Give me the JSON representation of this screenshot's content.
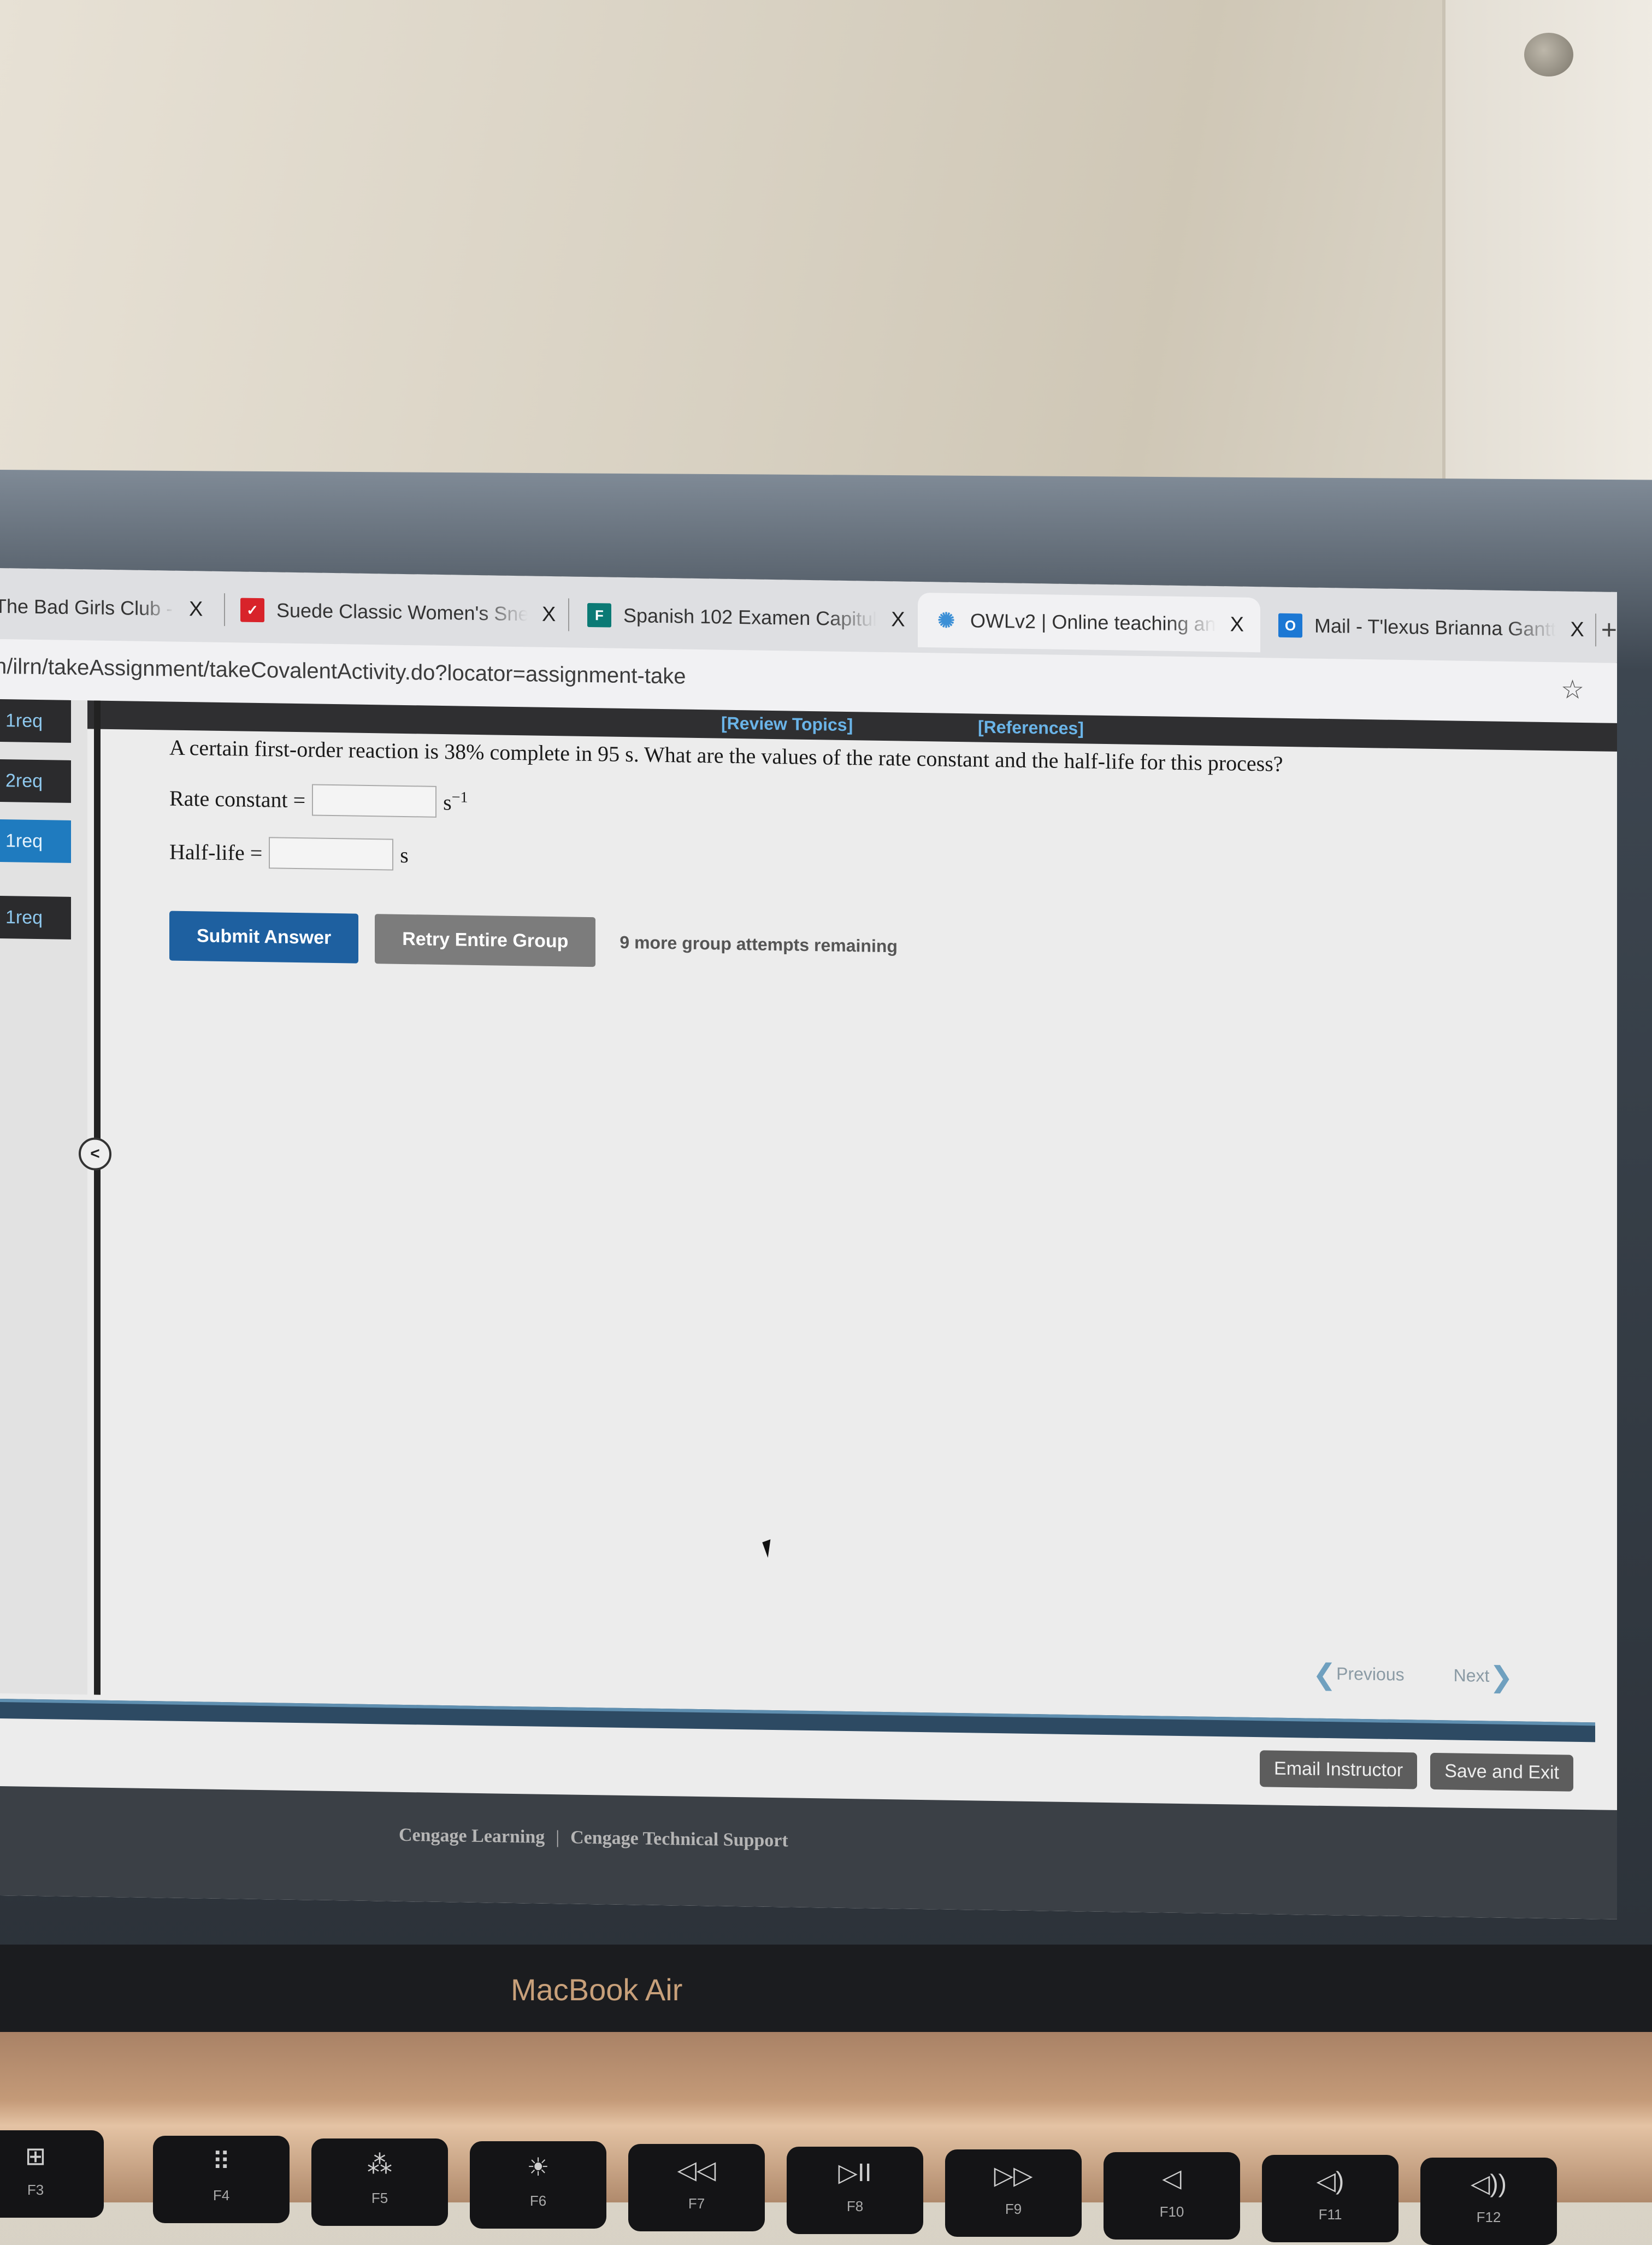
{
  "browser": {
    "tabs": [
      {
        "title": "The Bad Girls Club - S",
        "icon": "generic-page-icon",
        "active": false
      },
      {
        "title": "Suede Classic Women's Sne",
        "icon": "puma-logo-icon",
        "active": false
      },
      {
        "title": "Spanish 102 Examen Capitul",
        "icon": "microsoft-forms-icon",
        "active": false
      },
      {
        "title": "OWLv2 | Online teaching an",
        "icon": "owl-loading-icon",
        "active": true
      },
      {
        "title": "Mail - T'lexus Brianna Gantt",
        "icon": "outlook-icon",
        "active": false
      }
    ],
    "close_glyph": "X",
    "new_tab_glyph": "+",
    "url": "n/ilrn/takeAssignment/takeCovalentActivity.do?locator=assignment-take",
    "bookmark_glyph": "☆"
  },
  "page": {
    "top_links": {
      "review_topics": "[Review Topics]",
      "references": "[References]"
    },
    "sidebar": {
      "items": [
        {
          "label": "1req",
          "active": false
        },
        {
          "label": "2req",
          "active": false
        },
        {
          "label": "1req",
          "active": true
        },
        {
          "label": "1req",
          "active": false
        }
      ],
      "collapse_glyph": "<"
    },
    "question": {
      "text": "A certain first-order reaction is 38% complete in 95 s. What are the values of the rate constant and the half-life for this process?",
      "fields": [
        {
          "label": "Rate constant =",
          "value": "",
          "unit": "s",
          "unit_exponent": "−1"
        },
        {
          "label": "Half-life =",
          "value": "",
          "unit": "s",
          "unit_exponent": ""
        }
      ]
    },
    "actions": {
      "submit": "Submit Answer",
      "retry": "Retry Entire Group",
      "attempts_remaining": "9 more group attempts remaining"
    },
    "pager": {
      "previous": "Previous",
      "next": "Next"
    },
    "footer_buttons": {
      "email_instructor": "Email Instructor",
      "save_and_exit": "Save and Exit"
    },
    "footer_links": {
      "cengage_learning": "Cengage Learning",
      "separator": "|",
      "tech_support": "Cengage Technical Support"
    }
  },
  "device": {
    "brand": "MacBook Air",
    "function_keys": [
      {
        "glyph": "⊞",
        "label": "F3"
      },
      {
        "glyph": "⠿",
        "label": "F4"
      },
      {
        "glyph": "⁂",
        "label": "F5"
      },
      {
        "glyph": "☀",
        "label": "F6"
      },
      {
        "glyph": "◁◁",
        "label": "F7"
      },
      {
        "glyph": "▷II",
        "label": "F8"
      },
      {
        "glyph": "▷▷",
        "label": "F9"
      },
      {
        "glyph": "◁",
        "label": "F10"
      },
      {
        "glyph": "◁)",
        "label": "F11"
      },
      {
        "glyph": "◁))",
        "label": "F12"
      }
    ]
  }
}
